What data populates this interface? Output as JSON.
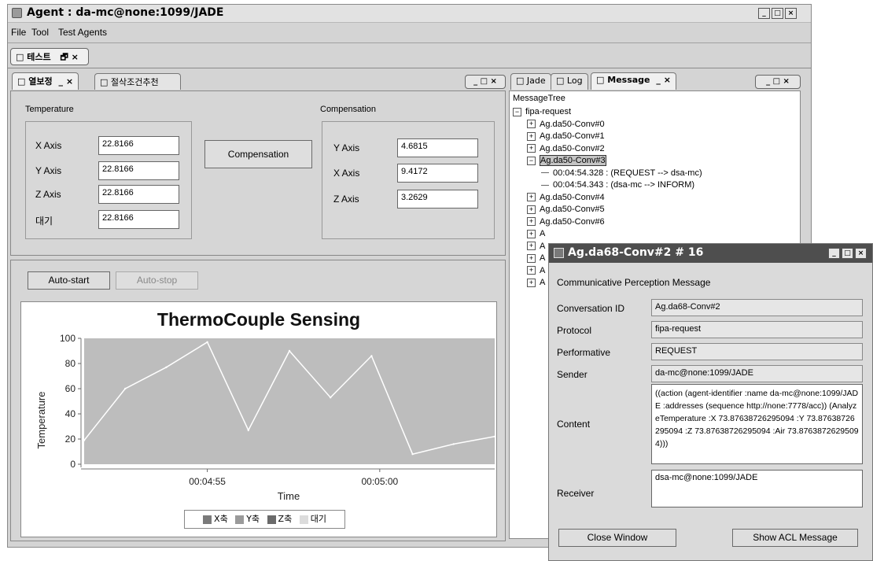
{
  "app": {
    "title": "Agent : da-mc@none:1099/JADE",
    "menu": [
      "File",
      "Tool",
      "Test Agents"
    ],
    "top_tab": "테스트"
  },
  "left_panel": {
    "tabs": [
      "열보정",
      "절삭조건추천"
    ],
    "temperature_group": {
      "title": "Temperature",
      "rows": [
        {
          "label": "X Axis",
          "value": "22.8166"
        },
        {
          "label": "Y Axis",
          "value": "22.8166"
        },
        {
          "label": "Z Axis",
          "value": "22.8166"
        },
        {
          "label": "대기",
          "value": "22.8166"
        }
      ]
    },
    "compensation_button": "Compensation",
    "compensation_group": {
      "title": "Compensation",
      "rows": [
        {
          "label": "Y Axis",
          "value": "4.6815"
        },
        {
          "label": "X Axis",
          "value": "9.4172"
        },
        {
          "label": "Z Axis",
          "value": "3.2629"
        }
      ]
    },
    "auto_start": "Auto-start",
    "auto_stop": "Auto-stop"
  },
  "chart_data": {
    "type": "line",
    "title": "ThermoCouple Sensing",
    "xlabel": "Time",
    "ylabel": "Temperature",
    "ylim": [
      0,
      100
    ],
    "y_ticks": [
      "0",
      "20",
      "40",
      "60",
      "80",
      "100"
    ],
    "x_ticks": [
      "00:04:55",
      "00:05:00"
    ],
    "legend": [
      "X축",
      "Y축",
      "Z축",
      "대기"
    ],
    "legend_colors": [
      "#7a7a7a",
      "#9a9a9a",
      "#6a6a6a",
      "#d0d0d0"
    ],
    "background": "#bdbdbd",
    "line_color": "#ffffff",
    "series": [
      {
        "name": "X축",
        "x": [
          0,
          1,
          2,
          3,
          4,
          5,
          6,
          7,
          8,
          9,
          10
        ],
        "values": [
          19,
          60,
          77,
          97,
          27,
          90,
          53,
          86,
          8,
          16,
          22
        ]
      }
    ]
  },
  "right_panel": {
    "tabs": [
      "Jade",
      "Log",
      "Message"
    ],
    "tree_root": "MessageTree",
    "tree": [
      {
        "text": "fipa-request",
        "level": 0,
        "expander": "minus"
      },
      {
        "text": "Ag.da50-Conv#0",
        "level": 1,
        "expander": "plus"
      },
      {
        "text": "Ag.da50-Conv#1",
        "level": 1,
        "expander": "plus"
      },
      {
        "text": "Ag.da50-Conv#2",
        "level": 1,
        "expander": "plus"
      },
      {
        "text": "Ag.da50-Conv#3",
        "level": 1,
        "expander": "minus",
        "selected": true
      },
      {
        "text": "00:04:54.328 : (REQUEST --> dsa-mc)",
        "level": 2,
        "expander": "none"
      },
      {
        "text": "00:04:54.343 : (dsa-mc --> INFORM)",
        "level": 2,
        "expander": "none"
      },
      {
        "text": "Ag.da50-Conv#4",
        "level": 1,
        "expander": "plus"
      },
      {
        "text": "Ag.da50-Conv#5",
        "level": 1,
        "expander": "plus"
      },
      {
        "text": "Ag.da50-Conv#6",
        "level": 1,
        "expander": "plus"
      },
      {
        "text": "A",
        "level": 1,
        "expander": "plus"
      },
      {
        "text": "A",
        "level": 1,
        "expander": "plus"
      },
      {
        "text": "A",
        "level": 1,
        "expander": "plus"
      },
      {
        "text": "A",
        "level": 1,
        "expander": "plus"
      },
      {
        "text": "A",
        "level": 1,
        "expander": "plus"
      }
    ]
  },
  "dialog": {
    "title": "Ag.da68-Conv#2 # 16",
    "heading": "Communicative Perception Message",
    "conversation_id_label": "Conversation ID",
    "conversation_id": "Ag.da68-Conv#2",
    "protocol_label": "Protocol",
    "protocol": "fipa-request",
    "performative_label": "Performative",
    "performative": "REQUEST",
    "sender_label": "Sender",
    "sender": "da-mc@none:1099/JADE",
    "content_label": "Content",
    "content": "((action (agent-identifier :name da-mc@none:1099/JADE :addresses (sequence http://none:7778/acc)) (AnalyzeTemperature :X 73.87638726295094 :Y 73.87638726295094 :Z 73.87638726295094 :Air 73.87638726295094)))",
    "receiver_label": "Receiver",
    "receiver": "dsa-mc@none:1099/JADE",
    "close_button": "Close Window",
    "show_acl_button": "Show ACL Message"
  }
}
